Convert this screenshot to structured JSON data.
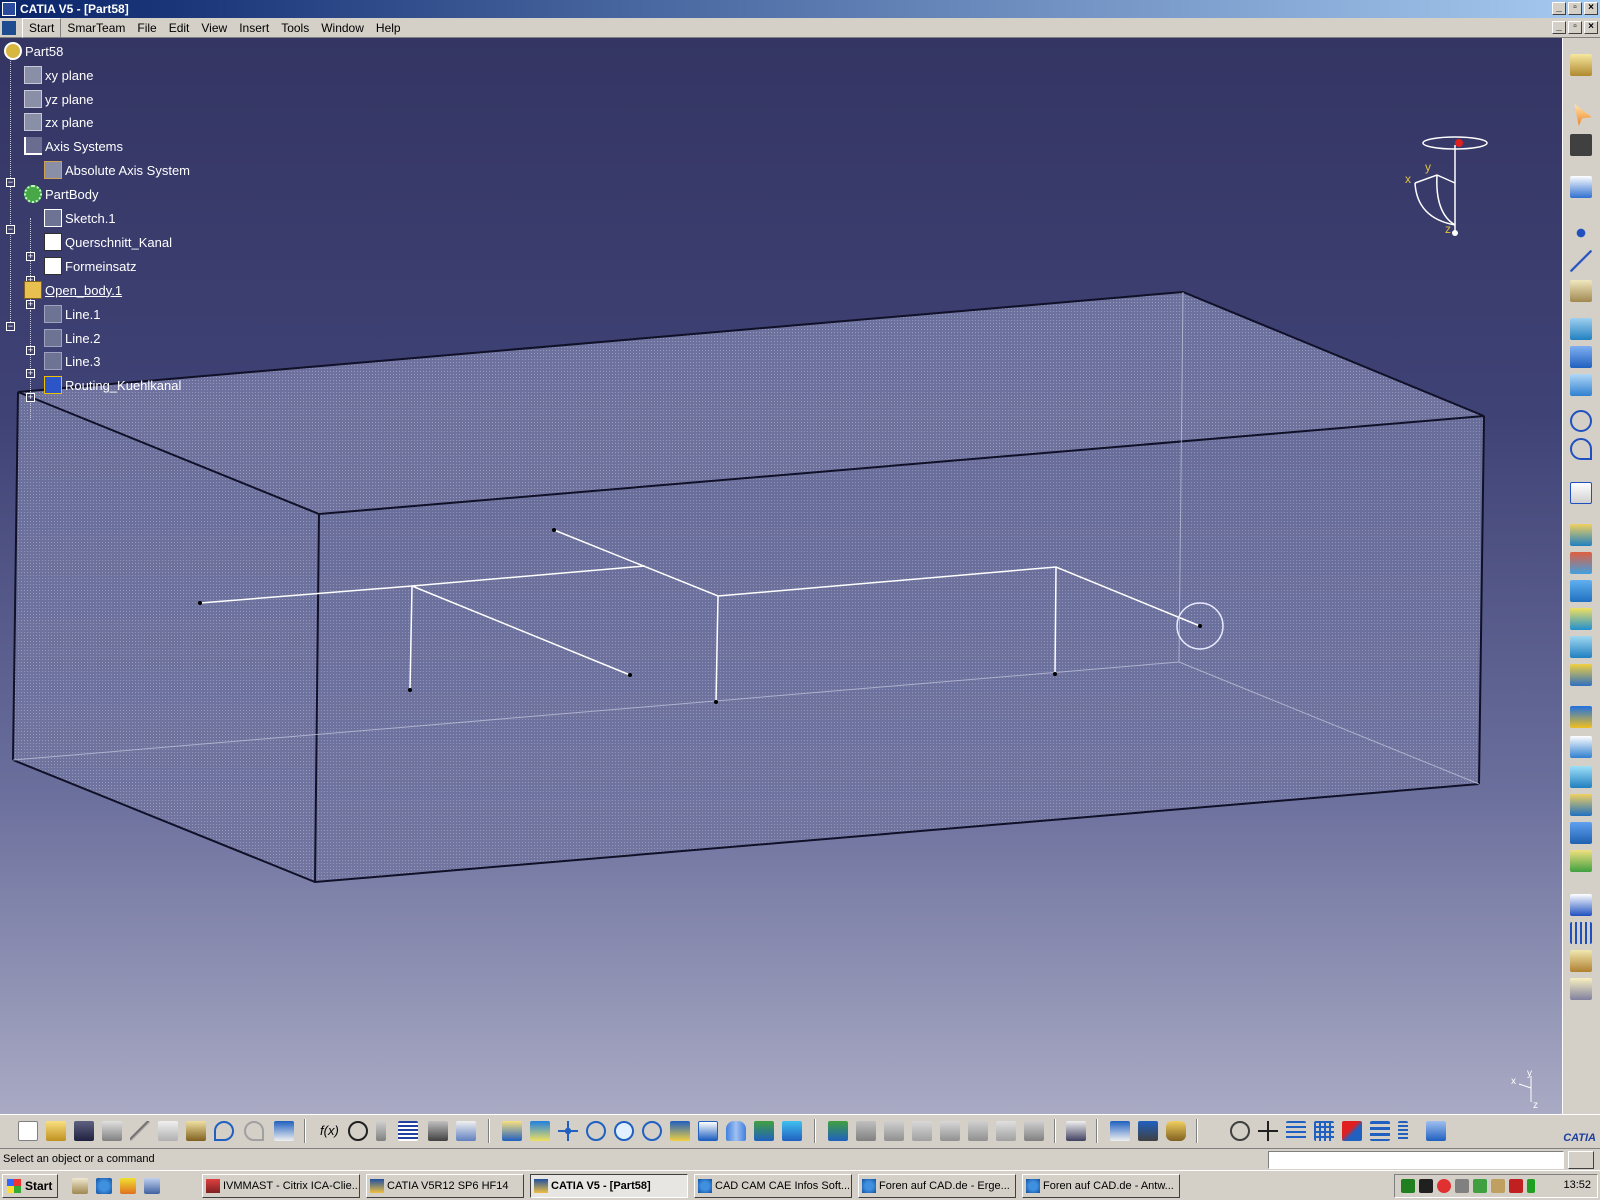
{
  "window": {
    "title": "CATIA V5 - [Part58]"
  },
  "menubar": {
    "items": [
      "Start",
      "SmarTeam",
      "File",
      "Edit",
      "View",
      "Insert",
      "Tools",
      "Window",
      "Help"
    ]
  },
  "tree": {
    "root": "Part58",
    "xy_plane": "xy plane",
    "yz_plane": "yz plane",
    "zx_plane": "zx plane",
    "axis_systems": "Axis Systems",
    "absolute_axis": "Absolute Axis System",
    "partbody": "PartBody",
    "sketch1": "Sketch.1",
    "querschnitt": "Querschnitt_Kanal",
    "formeinsatz": "Formeinsatz",
    "open_body": "Open_body.1",
    "line1": "Line.1",
    "line2": "Line.2",
    "line3": "Line.3",
    "routing": "Routing_Kuehlkanal"
  },
  "compass": {
    "x": "x",
    "y": "y",
    "z": "z"
  },
  "axis_indicator": {
    "x": "x",
    "y": "y",
    "z": "z"
  },
  "statusbar": {
    "message": "Select an object or a command",
    "command_value": ""
  },
  "toolbar": {
    "logo_text": "CATIA"
  },
  "taskbar": {
    "start": "Start",
    "tasks": [
      "IVMMAST - Citrix ICA-Clie...",
      "CATIA V5R12 SP6 HF14",
      "CATIA V5 - [Part58]",
      "CAD CAM CAE Infos Soft...",
      "Foren auf CAD.de - Erge...",
      "Foren auf CAD.de - Antw..."
    ],
    "clock": "13:52"
  },
  "colors": {
    "viewport_top": "#343563",
    "viewport_bottom": "#a9aac4",
    "box_face": "#6e72a0",
    "wire": "#ffffff"
  }
}
